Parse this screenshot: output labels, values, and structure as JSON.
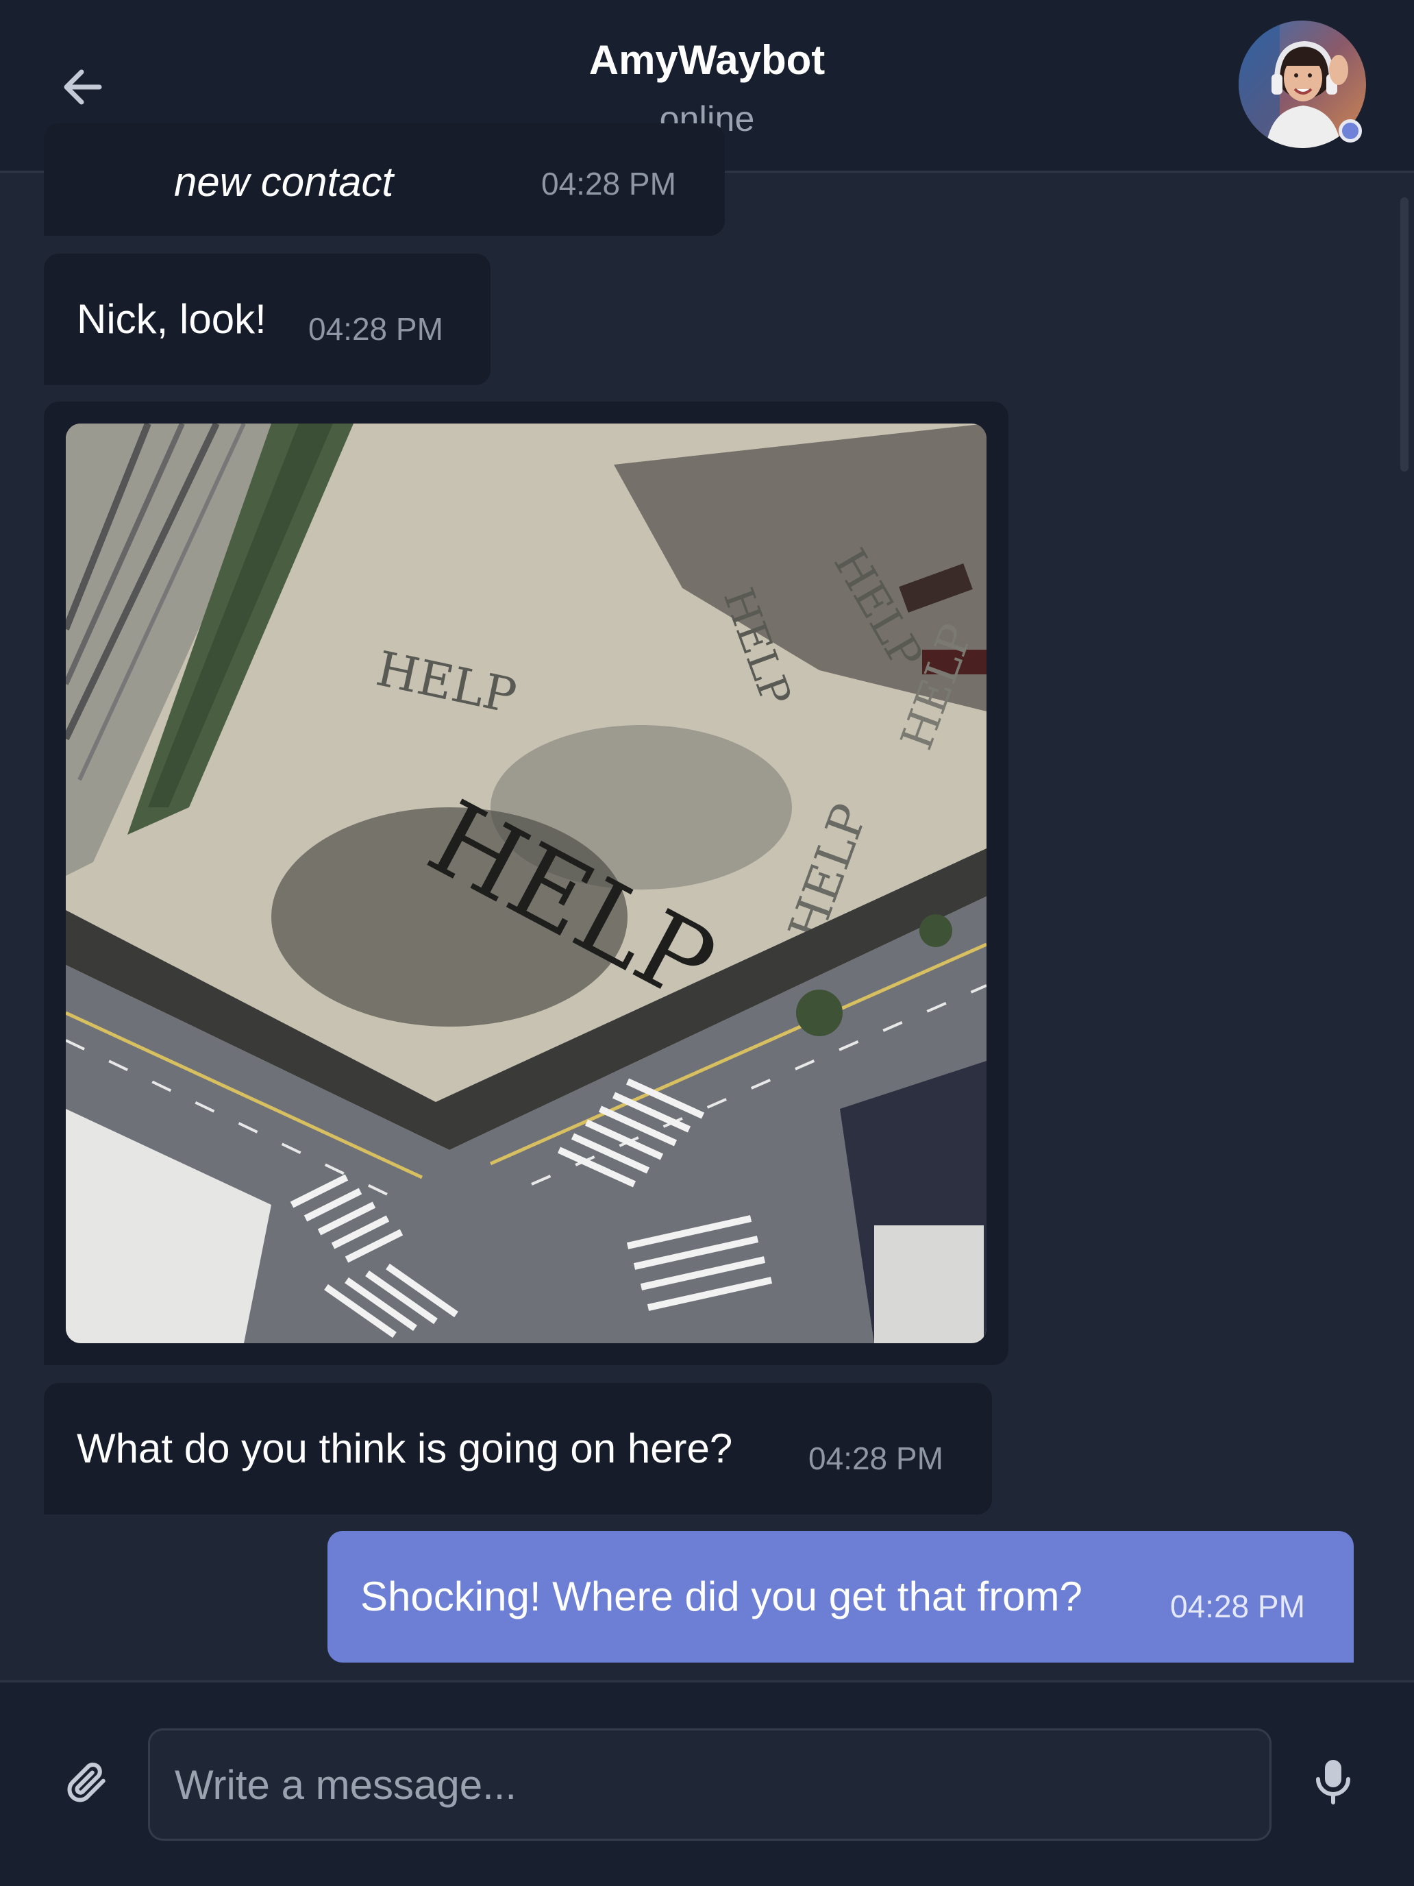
{
  "header": {
    "back_icon": "arrow-left-icon",
    "title": "AmyWaybot",
    "status": "online",
    "avatar_status_color": "#6e82d8"
  },
  "messages": [
    {
      "direction": "incoming",
      "text": "new contact",
      "time": "04:28 PM"
    },
    {
      "direction": "incoming",
      "text": "Nick, look!",
      "time": "04:28 PM"
    },
    {
      "direction": "incoming",
      "type": "photo",
      "image_content_text": [
        "HELP",
        "HELP",
        "HELP",
        "HELP",
        "HELP",
        "HELP"
      ]
    },
    {
      "direction": "incoming",
      "text": "What do you think is going on here?",
      "time": "04:28 PM"
    },
    {
      "direction": "outgoing",
      "text": "Shocking! Where did you get that from?",
      "time": "04:28 PM"
    }
  ],
  "composer": {
    "attach_icon": "paperclip-icon",
    "placeholder": "Write a message...",
    "value": "",
    "mic_icon": "microphone-icon"
  },
  "colors": {
    "background": "#1f2636",
    "header": "#182030",
    "incoming_bubble": "#161c2a",
    "outgoing_bubble": "#6c7fd4",
    "accent": "#6e82d8"
  }
}
